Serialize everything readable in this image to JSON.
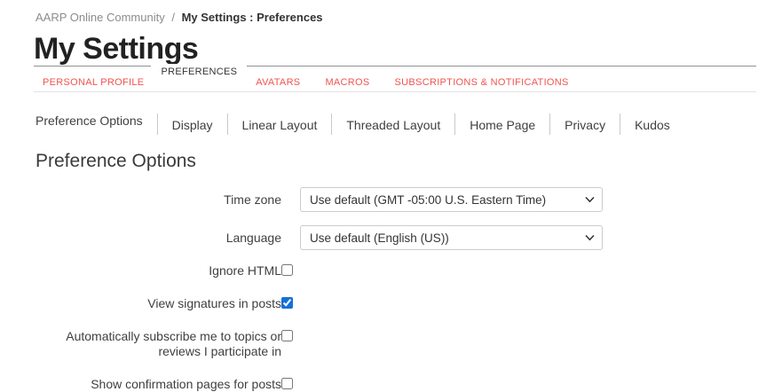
{
  "breadcrumb": {
    "root": "AARP Online Community",
    "separator": "/",
    "current": "My Settings : Preferences"
  },
  "page": {
    "title": "My Settings"
  },
  "main_tabs": [
    {
      "label": "PERSONAL PROFILE",
      "active": false
    },
    {
      "label": "PREFERENCES",
      "active": true
    },
    {
      "label": "AVATARS",
      "active": false
    },
    {
      "label": "MACROS",
      "active": false
    },
    {
      "label": "SUBSCRIPTIONS & NOTIFICATIONS",
      "active": false
    }
  ],
  "sub_tabs": [
    {
      "label": "Preference Options",
      "active": true
    },
    {
      "label": "Display",
      "active": false
    },
    {
      "label": "Linear Layout",
      "active": false
    },
    {
      "label": "Threaded Layout",
      "active": false
    },
    {
      "label": "Home Page",
      "active": false
    },
    {
      "label": "Privacy",
      "active": false
    },
    {
      "label": "Kudos",
      "active": false
    }
  ],
  "section": {
    "heading": "Preference Options"
  },
  "form": {
    "rows": [
      {
        "label": "Time zone",
        "control": "select",
        "value": "Use default (GMT -05:00 U.S. Eastern Time)"
      },
      {
        "label": "Language",
        "control": "select",
        "value": "Use default (English (US))"
      },
      {
        "label": "Ignore HTML",
        "control": "checkbox",
        "checked": false
      },
      {
        "label": "View signatures in posts",
        "control": "checkbox",
        "checked": true,
        "checked_attr": "checked"
      },
      {
        "label": "Automatically subscribe me to topics or reviews I participate in",
        "control": "checkbox",
        "checked": false
      },
      {
        "label": "Show confirmation pages for posts",
        "control": "checkbox",
        "checked": false
      }
    ]
  },
  "icons": {
    "select_dropdown": "chevron-down-icon"
  },
  "colors": {
    "tab_red": "#f0544f",
    "active_tab_text": "#333333",
    "checkbox_checked_blue": "#1570d6",
    "select_border": "#cccccc",
    "subtab_divider": "#c9c9c9",
    "tabs_top_rule": "#919191",
    "tabs_bottom_rule": "#e3e3e3",
    "breadcrumb_gray": "#8c8c8c"
  }
}
